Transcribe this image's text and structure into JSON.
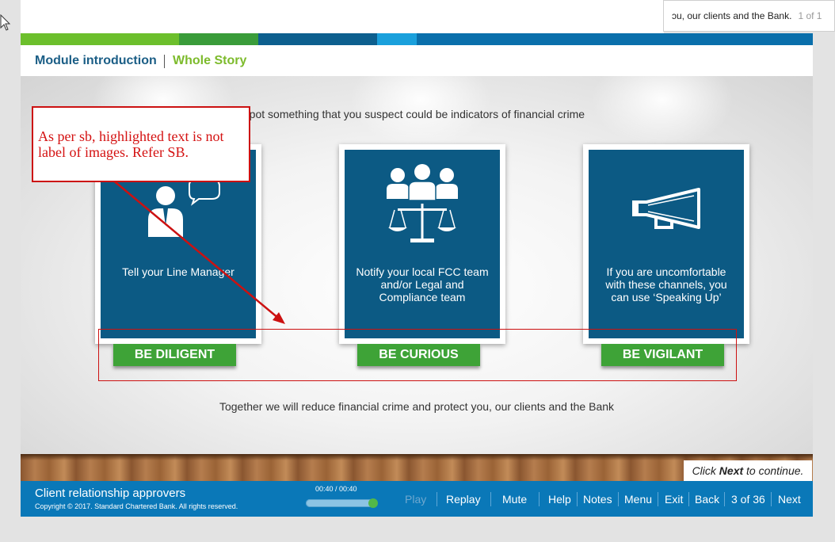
{
  "find_bar": {
    "text": "ɔu, our clients and the Bank.",
    "count": "1 of 1"
  },
  "header": {
    "module_link": "Module introduction",
    "story_link": "Whole Story"
  },
  "stage": {
    "intro_text": "u spot something that you suspect could be indicators of financial crime",
    "cards": [
      {
        "label": "Tell your Line Manager",
        "button": "BE DILIGENT",
        "icon": "person-speech-bubble-icon"
      },
      {
        "label": "Notify your local FCC team and/or Legal and Compliance team",
        "button": "BE CURIOUS",
        "icon": "team-scales-icon"
      },
      {
        "label": "If you are uncomfortable with these channels, you can use ‘Speaking Up’",
        "button": "BE VIGILANT",
        "icon": "megaphone-icon"
      }
    ],
    "together_text": "Together we will reduce financial crime and protect you, our clients and the Bank",
    "click_next_prefix": "Click ",
    "click_next_bold": "Next",
    "click_next_suffix": " to continue."
  },
  "annotation": {
    "note_text": "As per sb, highlighted text is not label of images. Refer SB."
  },
  "footer": {
    "course_title": "Client relationship approvers",
    "copyright": "Copyright © 2017. Standard Chartered Bank. All rights reserved.",
    "time": "00:40 / 00:40",
    "progress_fraction": 1.0,
    "nav": {
      "play": "Play",
      "replay": "Replay",
      "mute": "Mute",
      "help": "Help",
      "notes": "Notes",
      "menu": "Menu",
      "exit": "Exit",
      "back": "Back",
      "page": "3 of 36",
      "next": "Next"
    }
  },
  "colors": {
    "navy": "#0c5a84",
    "green_button": "#3ea337",
    "footer_blue": "#0a78b8",
    "annotation_red": "#cc1111"
  }
}
